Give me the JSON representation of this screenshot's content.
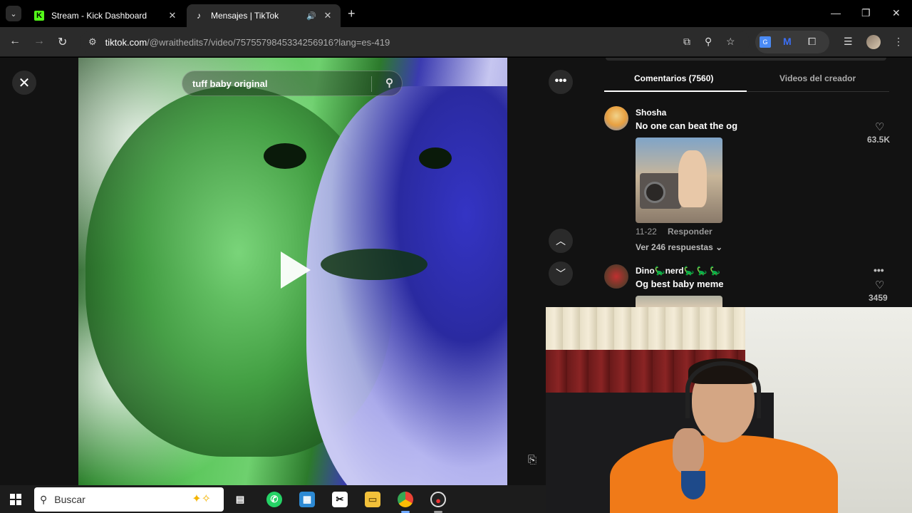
{
  "browser": {
    "tabs": [
      {
        "title": "Stream - Kick Dashboard",
        "icon": "kick-logo",
        "active": false
      },
      {
        "title": "Mensajes | TikTok",
        "icon": "tiktok-logo",
        "active": true,
        "audio": true
      }
    ],
    "url_domain": "tiktok.com",
    "url_path": "/@wraithedits7/video/7575579845334256916?lang=es-419"
  },
  "video": {
    "search_text": "tuff baby original"
  },
  "comments_panel": {
    "tabs": [
      {
        "label": "Comentarios (7560)",
        "active": true
      },
      {
        "label": "Videos del creador",
        "active": false
      }
    ],
    "comments": [
      {
        "username": "Shosha",
        "text": "No one can beat the og",
        "likes": "63.5K",
        "date": "11-22",
        "reply_label": "Responder",
        "replies_label": "Ver 246 respuestas"
      },
      {
        "username": "Dino🦕nerd🦕 🦕 🦕",
        "text": "Og best baby meme",
        "likes": "3459"
      }
    ]
  },
  "taskbar": {
    "search_placeholder": "Buscar",
    "apps": [
      "task-view",
      "whatsapp",
      "store",
      "capcut",
      "file-explorer",
      "chrome",
      "obs"
    ]
  },
  "colors": {
    "kick_green": "#53fc18",
    "background": "#121212",
    "accent_blue": "#3b6ff5"
  }
}
